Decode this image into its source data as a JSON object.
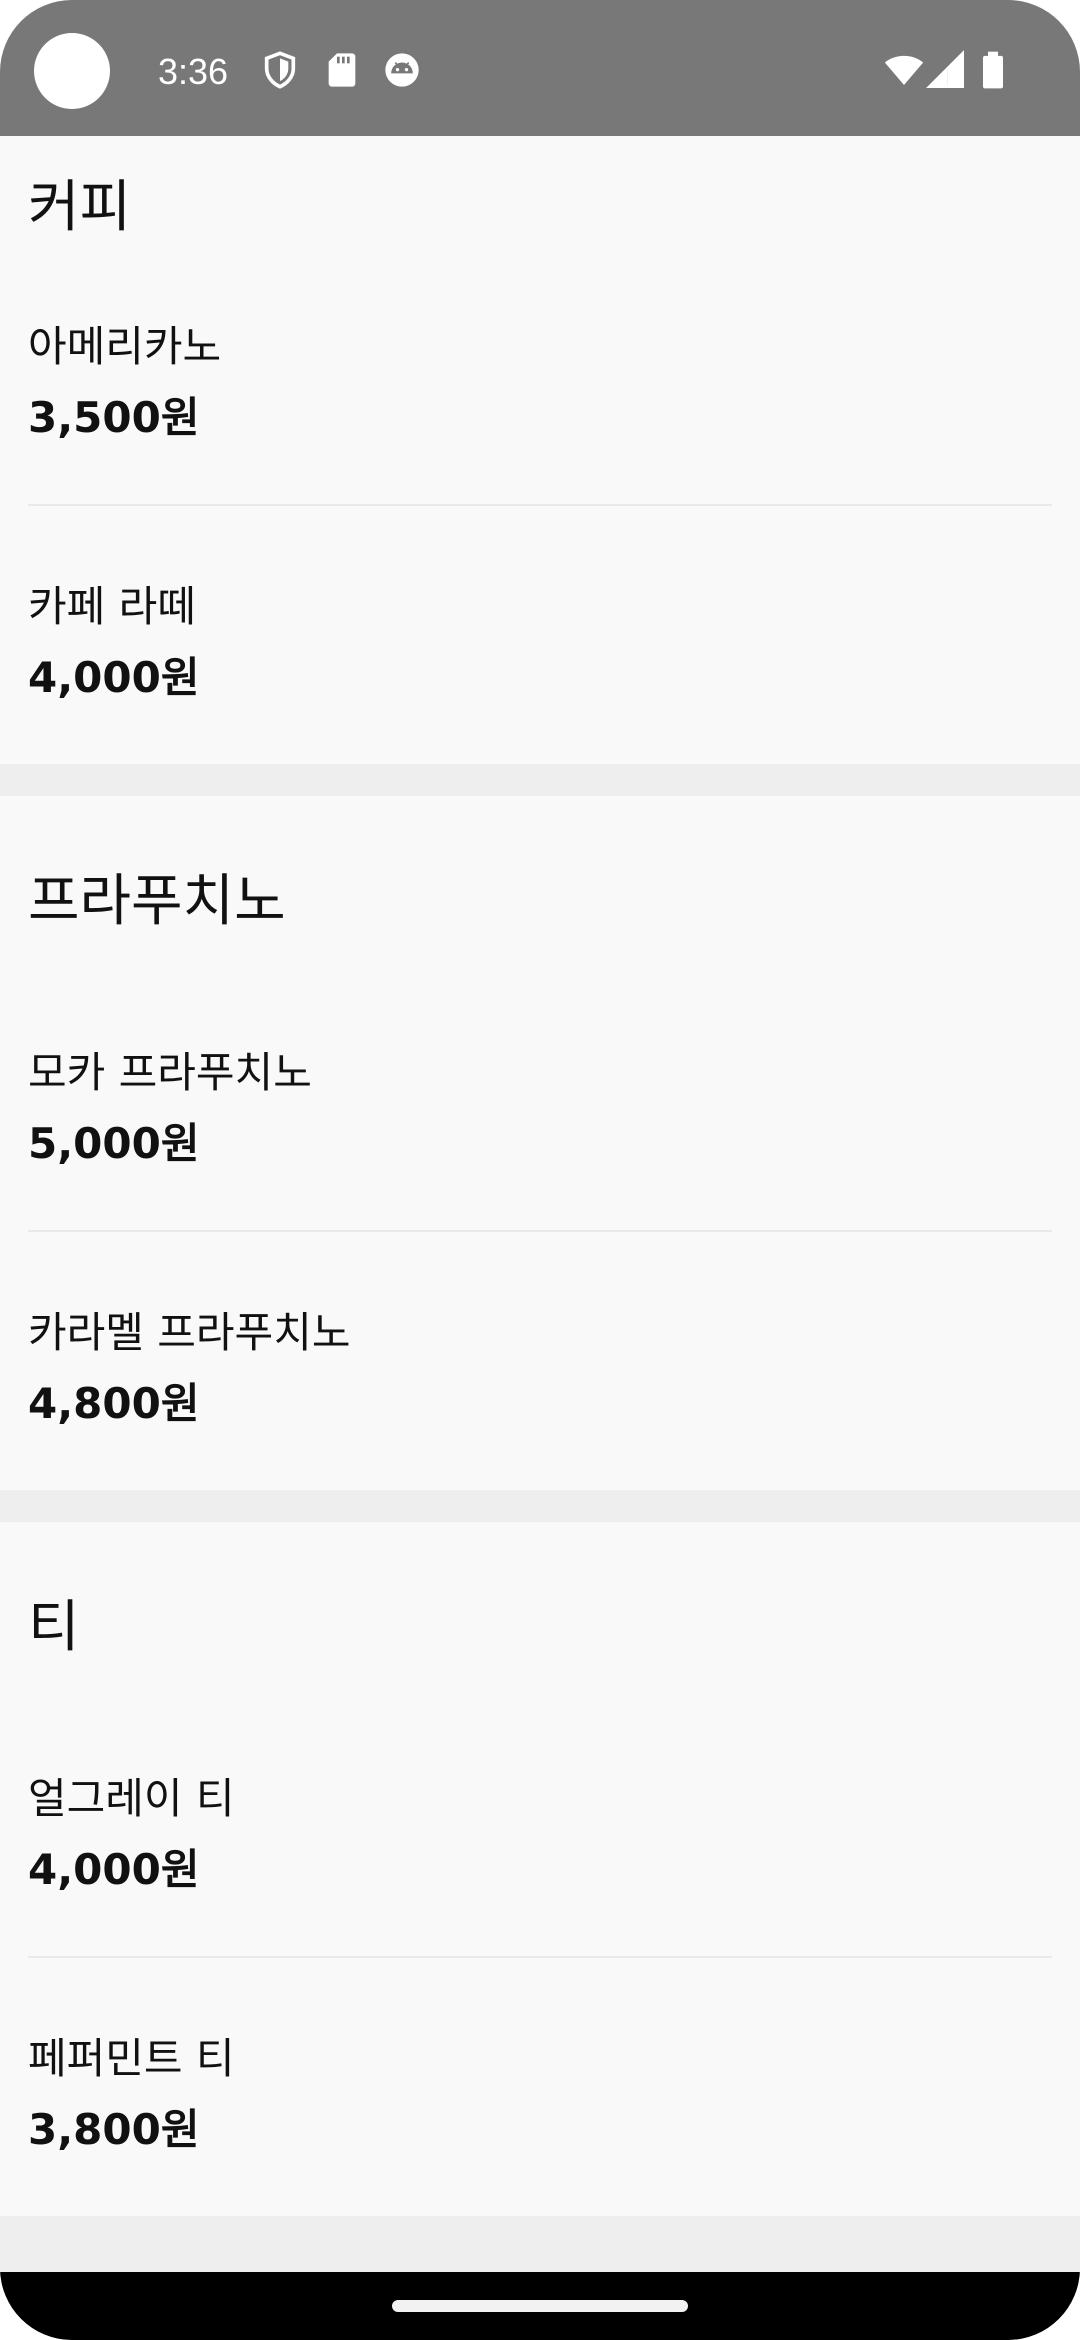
{
  "status_bar": {
    "time": "3:36",
    "icons_left": [
      "shield-icon",
      "sd-card-icon",
      "android-face-icon"
    ],
    "icons_right": [
      "wifi-icon",
      "cell-signal-icon",
      "battery-icon"
    ]
  },
  "sections": [
    {
      "title": "커피",
      "items": [
        {
          "name": "아메리카노",
          "price": "3,500원"
        },
        {
          "name": "카페 라떼",
          "price": "4,000원"
        }
      ]
    },
    {
      "title": "프라푸치노",
      "items": [
        {
          "name": "모카 프라푸치노",
          "price": "5,000원"
        },
        {
          "name": "카라멜 프라푸치노",
          "price": "4,800원"
        }
      ]
    },
    {
      "title": "티",
      "items": [
        {
          "name": "얼그레이 티",
          "price": "4,000원"
        },
        {
          "name": "페퍼민트 티",
          "price": "3,800원"
        }
      ]
    }
  ],
  "colors": {
    "status_bar": "#787878",
    "section_bg": "#f9f9f9",
    "gap_bg": "#eeeeee",
    "divider": "#e9e9e9",
    "nav_bar": "#000000"
  }
}
